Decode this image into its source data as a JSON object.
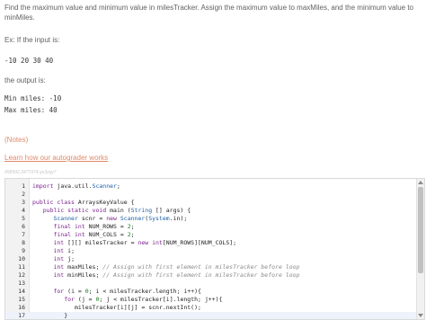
{
  "prompt": {
    "text": "Find the maximum value and minimum value in milesTracker. Assign the maximum value to maxMiles, and the minimum value to minMiles.",
    "example_label": "Ex: If the input is:",
    "input_value": "-10 20 30 40",
    "output_label": "the output is:",
    "output_lines": [
      "Min miles: -10",
      "Max miles: 40"
    ]
  },
  "links": {
    "notes": "(Notes)",
    "autograder": "Learn how our autograder works"
  },
  "editor": {
    "hash": "458992.3477974.qx3zqy7",
    "lines": [
      {
        "num": "1",
        "code": "import java.util.Scanner;"
      },
      {
        "num": "2",
        "code": ""
      },
      {
        "num": "3",
        "code": "public class ArraysKeyValue {"
      },
      {
        "num": "4",
        "code": "   public static void main (String [] args) {"
      },
      {
        "num": "5",
        "code": "      Scanner scnr = new Scanner(System.in);"
      },
      {
        "num": "6",
        "code": "      final int NUM_ROWS = 2;"
      },
      {
        "num": "7",
        "code": "      final int NUM_COLS = 2;"
      },
      {
        "num": "8",
        "code": "      int [][] milesTracker = new int[NUM_ROWS][NUM_COLS];"
      },
      {
        "num": "9",
        "code": "      int i;"
      },
      {
        "num": "10",
        "code": "      int j;"
      },
      {
        "num": "11",
        "code": "      int maxMiles; // Assign with first element in milesTracker before loop"
      },
      {
        "num": "12",
        "code": "      int minMiles; // Assign with first element in milesTracker before loop"
      },
      {
        "num": "13",
        "code": ""
      },
      {
        "num": "14",
        "code": "      for (i = 0; i < milesTracker.length; i++){"
      },
      {
        "num": "15",
        "code": "         for (j = 0; j < milesTracker[i].length; j++){"
      },
      {
        "num": "16",
        "code": "            milesTracker[i][j] = scnr.nextInt();"
      },
      {
        "num": "17",
        "code": "         }"
      }
    ]
  }
}
